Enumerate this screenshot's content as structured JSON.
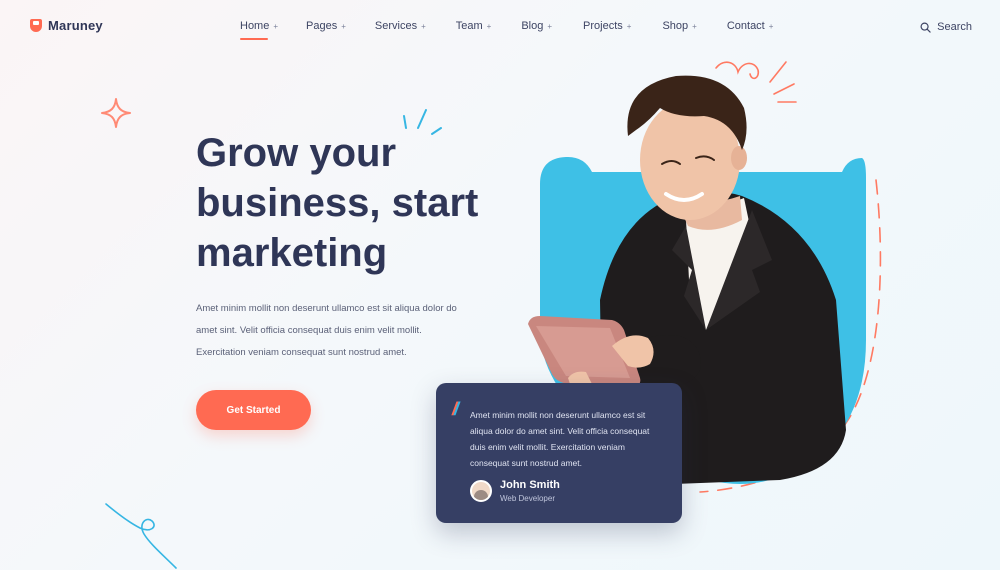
{
  "brand": {
    "name": "Maruney",
    "accent": "#ff6a52",
    "secondary": "#36b6e3",
    "dark": "#363f64"
  },
  "nav": {
    "items": [
      {
        "label": "Home",
        "active": true,
        "caret": "+"
      },
      {
        "label": "Pages",
        "caret": "+"
      },
      {
        "label": "Services",
        "caret": "+"
      },
      {
        "label": "Team",
        "caret": "+"
      },
      {
        "label": "Blog",
        "caret": "+"
      },
      {
        "label": "Projects",
        "caret": "+"
      },
      {
        "label": "Shop",
        "caret": "+"
      },
      {
        "label": "Contact",
        "caret": "+"
      }
    ],
    "search_label": "Search",
    "search_icon": "search-icon"
  },
  "hero": {
    "headline_lines": [
      "Grow your",
      "business, start",
      "marketing"
    ],
    "description_lines": [
      "Amet minim mollit non deserunt ullamco est sit aliqua dolor do",
      "amet sint. Velit officia consequat duis enim velit mollit.",
      "Exercitation veniam consequat sunt nostrud amet."
    ],
    "cta_label": "Get Started"
  },
  "testimonial": {
    "quote_lines": [
      "Amet minim mollit non deserunt ullamco est sit",
      "aliqua dolor do amet sint. Velit officia consequat",
      "duis enim velit mollit. Exercitation veniam",
      "consequat sunt nostrud amet."
    ],
    "author_name": "John Smith",
    "author_role": "Web Developer"
  }
}
